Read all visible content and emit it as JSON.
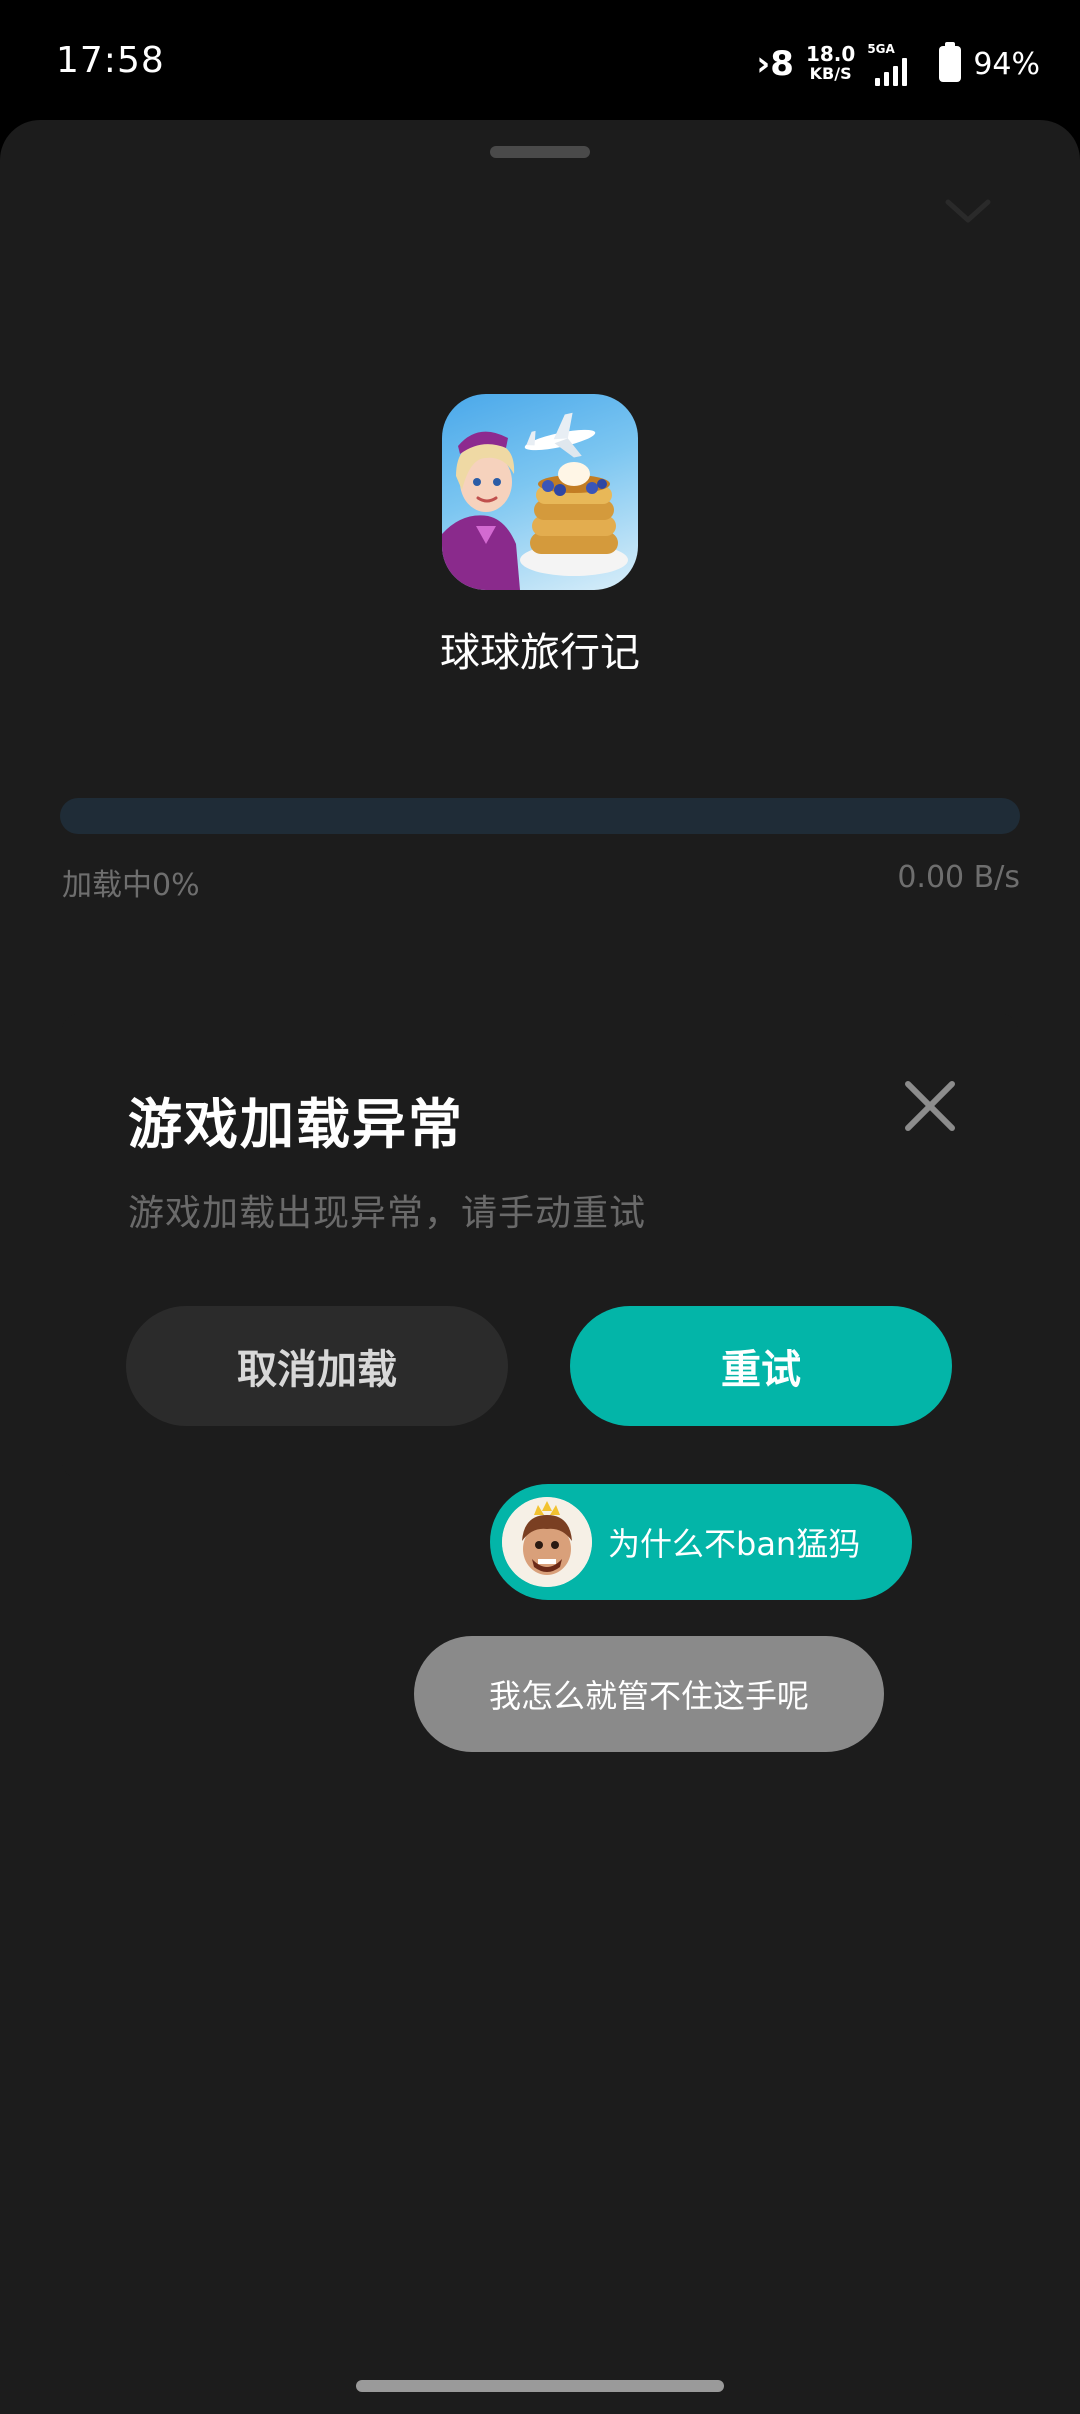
{
  "status_bar": {
    "time": "17:58",
    "nfc_icon": "nfc-icon",
    "net_speed_value": "18.0",
    "net_speed_unit": "KB/S",
    "network_type": "5GA",
    "battery_percent": "94%"
  },
  "game": {
    "name": "球球旅行记",
    "icon": "game-app-icon"
  },
  "progress": {
    "label": "加载中0%",
    "speed": "0.00 B/s",
    "percent": 0,
    "accent_color": "#03b5a8"
  },
  "dialog": {
    "title": "游戏加载异常",
    "message": "游戏加载出现异常，请手动重试",
    "cancel_label": "取消加载",
    "retry_label": "重试",
    "close_icon": "close-icon"
  },
  "danmaku": [
    {
      "text": "为什么不ban猛犸",
      "has_avatar": true
    },
    {
      "text": "我怎么就管不住这手呢",
      "has_avatar": false
    }
  ]
}
